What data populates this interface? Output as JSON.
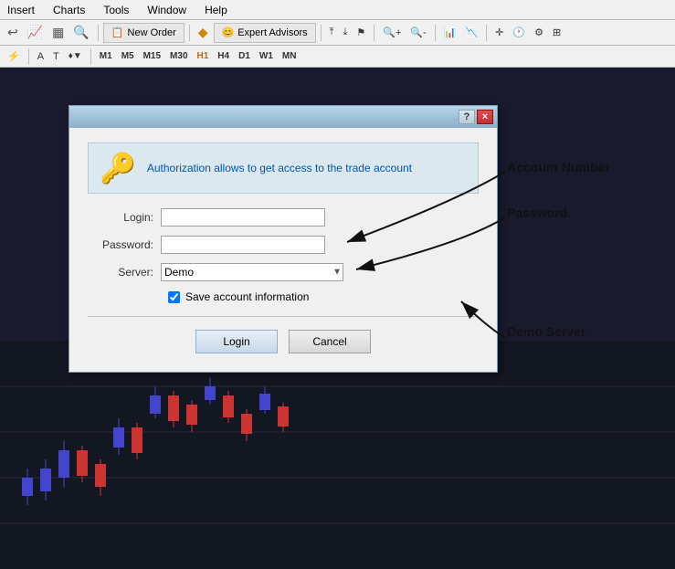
{
  "menubar": {
    "items": [
      "Insert",
      "Charts",
      "Tools",
      "Window",
      "Help"
    ]
  },
  "toolbar": {
    "new_order_label": "New Order",
    "expert_advisors_label": "Expert Advisors",
    "periods": [
      "M1",
      "M5",
      "M15",
      "M30",
      "H1",
      "H4",
      "D1",
      "W1",
      "MN"
    ]
  },
  "dialog": {
    "title": "",
    "help_label": "?",
    "close_label": "×",
    "description": "Authorization allows to get access to the trade account",
    "login_label": "Login:",
    "login_value": "",
    "password_label": "Password:",
    "password_value": "",
    "server_label": "Server:",
    "server_value": "Demo",
    "save_checkbox_label": "Save account information",
    "login_button": "Login",
    "cancel_button": "Cancel"
  },
  "annotations": {
    "account_number": "Account Number",
    "password": "Password",
    "demo_server": "Demo Server"
  }
}
